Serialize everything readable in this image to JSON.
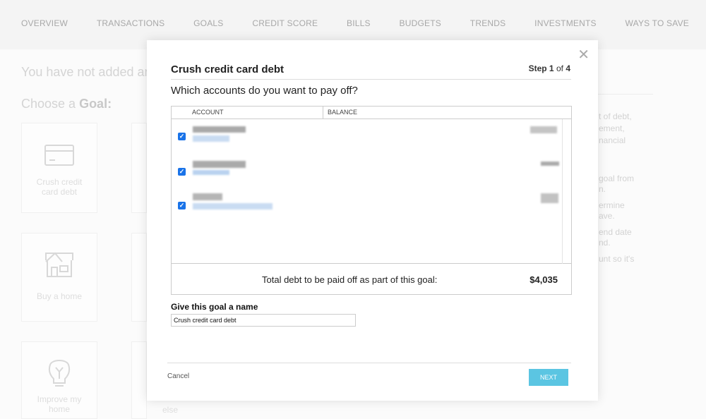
{
  "nav": [
    "OVERVIEW",
    "TRANSACTIONS",
    "GOALS",
    "CREDIT SCORE",
    "BILLS",
    "BUDGETS",
    "TRENDS",
    "INVESTMENTS",
    "WAYS TO SAVE"
  ],
  "background": {
    "headline": "You have not added an",
    "choose_prefix": "Choose a ",
    "choose_bold": "Goal:",
    "cards": [
      {
        "label": "Crush credit card debt",
        "icon": "credit-card-icon"
      },
      {
        "label": "Buy a home",
        "icon": "house-icon"
      },
      {
        "label": "Improve my home",
        "icon": "lightbulb-icon"
      }
    ],
    "second_col_partial": "else",
    "right_text": [
      "t of debt,",
      "ement,",
      "nancial",
      "",
      "goal from",
      "n.",
      "ermine",
      "ave.",
      "end date",
      "nd.",
      "unt so it's"
    ]
  },
  "modal": {
    "title": "Crush credit card debt",
    "step_word": "Step",
    "step_current": "1",
    "step_of": "of",
    "step_total": "4",
    "question": "Which accounts do you want to pay off?",
    "columns": [
      "ACCOUNT",
      "BALANCE"
    ],
    "accounts": [
      {
        "checked": true
      },
      {
        "checked": true
      },
      {
        "checked": true
      }
    ],
    "total_label": "Total debt to be paid off as part of this goal:",
    "total_value": "$4,035",
    "name_label": "Give this goal a name",
    "name_value": "Crush credit card debt",
    "cancel": "Cancel",
    "next": "NEXT",
    "next_color": "#5bc5e2",
    "checkbox_color": "#1a73e8"
  }
}
